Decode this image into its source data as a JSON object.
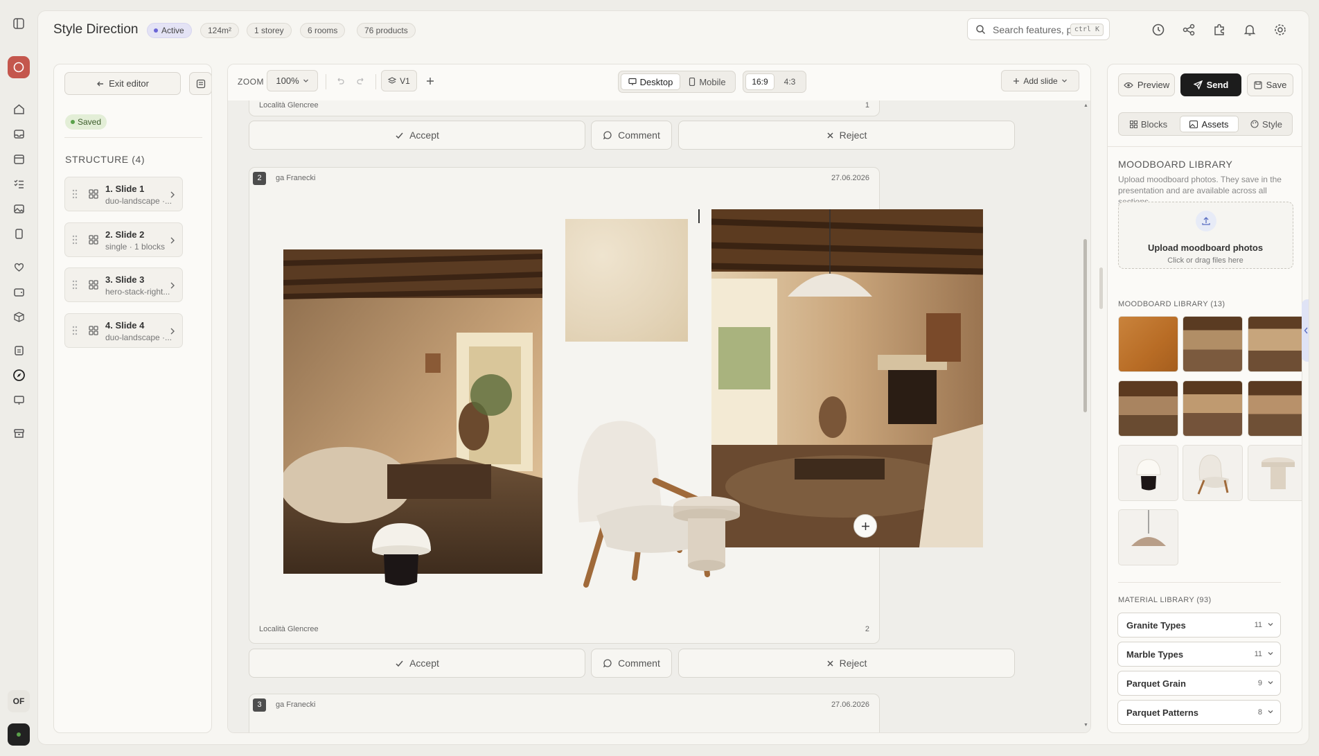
{
  "header": {
    "title": "Style Direction",
    "status": "Active",
    "chips": [
      "124m²",
      "1 storey",
      "6 rooms",
      "76 products"
    ],
    "search": {
      "placeholder": "Search features, pr...",
      "shortcut": "ctrl K"
    }
  },
  "user": {
    "initials": "OF"
  },
  "left_panel": {
    "exit_label": "Exit editor",
    "saved_label": "Saved",
    "structure_label": "STRUCTURE (4)",
    "slides": [
      {
        "title": "1. Slide 1",
        "subtitle": "duo-landscape ·..."
      },
      {
        "title": "2. Slide 2",
        "subtitle": "single · 1 blocks"
      },
      {
        "title": "3. Slide 3",
        "subtitle": "hero-stack-right..."
      },
      {
        "title": "4. Slide 4",
        "subtitle": "duo-landscape ·..."
      }
    ]
  },
  "toolbar": {
    "zoom_label": "ZOOM",
    "zoom_value": "100%",
    "version": "V1",
    "view_desktop": "Desktop",
    "view_mobile": "Mobile",
    "ratio_a": "16:9",
    "ratio_b": "4:3",
    "add_slide": "Add slide"
  },
  "canvas": {
    "top_card": {
      "location": "Località Glencree",
      "page": "1"
    },
    "slide2": {
      "number": "2",
      "author": "ga Franecki",
      "date": "27.06.2026",
      "location": "Località Glencree",
      "page": "2"
    },
    "slide3": {
      "number": "3",
      "author": "ga Franecki",
      "date": "27.06.2026"
    },
    "actions": {
      "accept": "Accept",
      "comment": "Comment",
      "reject": "Reject"
    }
  },
  "right_panel": {
    "preview": "Preview",
    "send": "Send",
    "save": "Save",
    "tabs": [
      "Blocks",
      "Assets",
      "Style"
    ],
    "active_tab": "Assets",
    "moodboard_title": "MOODBOARD LIBRARY",
    "moodboard_desc": "Upload moodboard photos. They save in the presentation and are available across all sections.",
    "upload_title": "Upload moodboard photos",
    "upload_sub": "Click or drag files here",
    "library_label": "MOODBOARD LIBRARY (13)",
    "material_label": "MATERIAL LIBRARY (93)",
    "materials": [
      {
        "name": "Granite Types",
        "count": "11"
      },
      {
        "name": "Marble Types",
        "count": "11"
      },
      {
        "name": "Parquet Grain",
        "count": "9"
      },
      {
        "name": "Parquet Patterns",
        "count": "8"
      }
    ]
  },
  "colors": {
    "accent": "#6b66d6",
    "send_bg": "#1c1c1c",
    "brand_red": "#c4574d",
    "saved_green": "#5aa14a"
  }
}
